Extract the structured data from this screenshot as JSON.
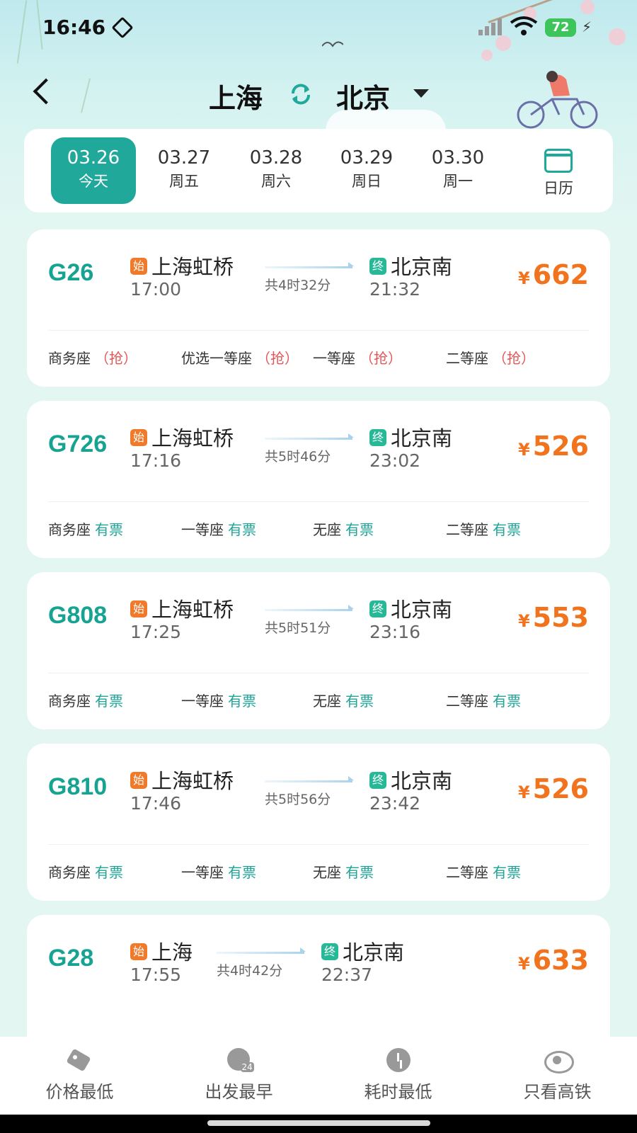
{
  "status_bar": {
    "time": "16:46",
    "battery": "72"
  },
  "header": {
    "from": "上海",
    "to": "北京"
  },
  "dates": [
    {
      "date": "03.26",
      "weekday": "今天",
      "active": true
    },
    {
      "date": "03.27",
      "weekday": "周五",
      "active": false
    },
    {
      "date": "03.28",
      "weekday": "周六",
      "active": false
    },
    {
      "date": "03.29",
      "weekday": "周日",
      "active": false
    },
    {
      "date": "03.30",
      "weekday": "周一",
      "active": false
    }
  ],
  "calendar_label": "日历",
  "badges": {
    "start": "始",
    "end": "终"
  },
  "currency": "¥",
  "trains": [
    {
      "no": "G26",
      "from": "上海虹桥",
      "dep": "17:00",
      "duration": "共4时32分",
      "to": "北京南",
      "arr": "21:32",
      "price": "662",
      "seats": [
        {
          "name": "商务座",
          "status": "（抢）",
          "type": "grab"
        },
        {
          "name": "优选一等座",
          "status": "（抢）",
          "type": "grab"
        },
        {
          "name": "一等座",
          "status": "（抢）",
          "type": "grab"
        },
        {
          "name": "二等座",
          "status": "（抢）",
          "type": "grab"
        }
      ]
    },
    {
      "no": "G726",
      "from": "上海虹桥",
      "dep": "17:16",
      "duration": "共5时46分",
      "to": "北京南",
      "arr": "23:02",
      "price": "526",
      "seats": [
        {
          "name": "商务座",
          "status": "有票",
          "type": "ok"
        },
        {
          "name": "一等座",
          "status": "有票",
          "type": "ok"
        },
        {
          "name": "无座",
          "status": "有票",
          "type": "ok"
        },
        {
          "name": "二等座",
          "status": "有票",
          "type": "ok"
        }
      ]
    },
    {
      "no": "G808",
      "from": "上海虹桥",
      "dep": "17:25",
      "duration": "共5时51分",
      "to": "北京南",
      "arr": "23:16",
      "price": "553",
      "seats": [
        {
          "name": "商务座",
          "status": "有票",
          "type": "ok"
        },
        {
          "name": "一等座",
          "status": "有票",
          "type": "ok"
        },
        {
          "name": "无座",
          "status": "有票",
          "type": "ok"
        },
        {
          "name": "二等座",
          "status": "有票",
          "type": "ok"
        }
      ]
    },
    {
      "no": "G810",
      "from": "上海虹桥",
      "dep": "17:46",
      "duration": "共5时56分",
      "to": "北京南",
      "arr": "23:42",
      "price": "526",
      "seats": [
        {
          "name": "商务座",
          "status": "有票",
          "type": "ok"
        },
        {
          "name": "一等座",
          "status": "有票",
          "type": "ok"
        },
        {
          "name": "无座",
          "status": "有票",
          "type": "ok"
        },
        {
          "name": "二等座",
          "status": "有票",
          "type": "ok"
        }
      ]
    },
    {
      "no": "G28",
      "from": "上海",
      "dep": "17:55",
      "duration": "共4时42分",
      "to": "北京南",
      "arr": "22:37",
      "price": "633",
      "seats": []
    }
  ],
  "bottom_tabs": [
    {
      "label": "价格最低",
      "icon": "tag-icon"
    },
    {
      "label": "出发最早",
      "icon": "clock-24-icon",
      "icon_text": "24"
    },
    {
      "label": "耗时最低",
      "icon": "clock-icon"
    },
    {
      "label": "只看高铁",
      "icon": "eye-icon"
    }
  ],
  "colors": {
    "accent": "#20a99b",
    "price": "#f2731e",
    "available": "#1ea497",
    "grab": "#e25757"
  }
}
